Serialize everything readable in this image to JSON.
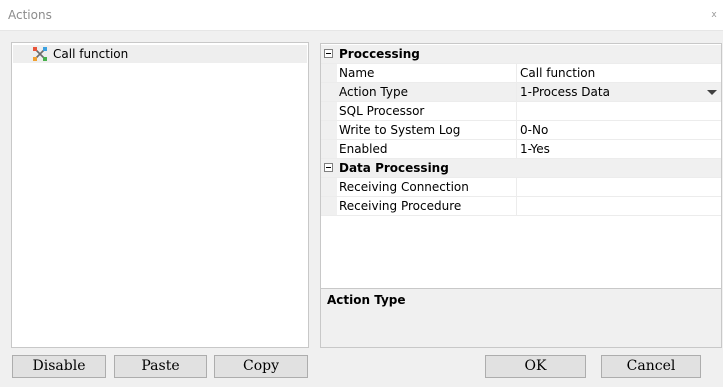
{
  "window": {
    "title": "Actions",
    "close_label": "x"
  },
  "tree": {
    "items": [
      {
        "label": "Call function",
        "icon": "function-icon"
      }
    ]
  },
  "properties": {
    "categories": [
      {
        "label": "Proccessing",
        "rows": [
          {
            "name": "Name",
            "value": "Call function"
          },
          {
            "name": "Action Type",
            "value": "1-Process Data"
          },
          {
            "name": "SQL Processor",
            "value": ""
          },
          {
            "name": "Write to System Log",
            "value": "0-No"
          },
          {
            "name": "Enabled",
            "value": "1-Yes"
          }
        ]
      },
      {
        "label": "Data Processing",
        "rows": [
          {
            "name": "Receiving Connection",
            "value": ""
          },
          {
            "name": "Receiving Procedure",
            "value": ""
          }
        ]
      }
    ],
    "description_title": "Action Type"
  },
  "buttons": {
    "disable": "Disable",
    "paste": "Paste",
    "copy": "Copy",
    "ok": "OK",
    "cancel": "Cancel"
  }
}
